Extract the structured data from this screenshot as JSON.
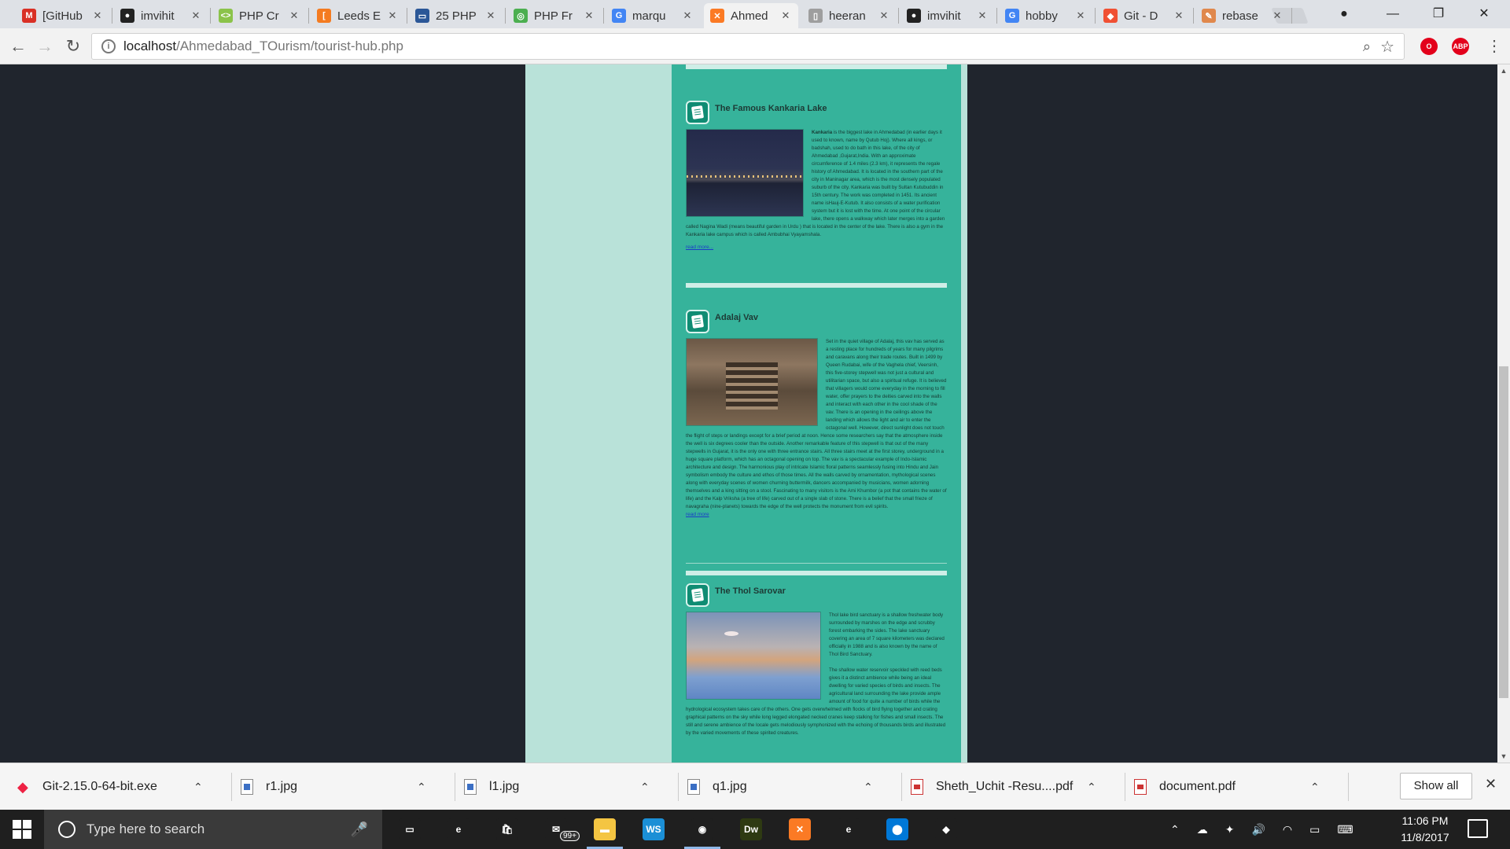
{
  "browser": {
    "tabs": [
      {
        "title": "[GitHub",
        "favicon": "gmail-icon",
        "color": "#d93025",
        "glyph": "M"
      },
      {
        "title": "imvihit",
        "favicon": "github-icon",
        "color": "#222222",
        "glyph": "●"
      },
      {
        "title": "PHP Cr",
        "favicon": "php-icon",
        "color": "#8bc34a",
        "glyph": "<>"
      },
      {
        "title": "Leeds E",
        "favicon": "leeds-icon",
        "color": "#f47b20",
        "glyph": "["
      },
      {
        "title": "25 PHP",
        "favicon": "monitor-icon",
        "color": "#2b5797",
        "glyph": "▭"
      },
      {
        "title": "PHP Fr",
        "favicon": "php-fr-icon",
        "color": "#4caf50",
        "glyph": "◎"
      },
      {
        "title": "marqu",
        "favicon": "google-icon",
        "color": "#4285f4",
        "glyph": "G"
      },
      {
        "title": "Ahmed",
        "favicon": "xampp-icon",
        "color": "#fb7a24",
        "glyph": "✕",
        "active": true
      },
      {
        "title": "heeran",
        "favicon": "page-icon",
        "color": "#9e9e9e",
        "glyph": "▯"
      },
      {
        "title": "imvihit",
        "favicon": "github-icon",
        "color": "#222222",
        "glyph": "●"
      },
      {
        "title": "hobby",
        "favicon": "google-icon",
        "color": "#4285f4",
        "glyph": "G"
      },
      {
        "title": "Git - D",
        "favicon": "git-icon",
        "color": "#f05033",
        "glyph": "◆"
      },
      {
        "title": "rebase",
        "favicon": "rebase-icon",
        "color": "#e0884c",
        "glyph": "✎"
      }
    ],
    "url_host": "localhost",
    "url_path": "/Ahmedabad_TOurism/tourist-hub.php"
  },
  "articles": [
    {
      "title": "The Famous Kankaria Lake",
      "lead": "Kankaria",
      "body": " is the biggest lake in Ahmedabad (in earlier days it used to known, name by Qutub Hoj). Where all kings, or badshah, used to do bath in this lake, of the city of Ahmedabad ,Gujarat,India. With an approximate circumference of 1.4 miles (2.3 km), it represents the regale history of Ahmedabad. It is located in the southern part of the city in Maninagar area, which is the most densely populated suburb of the city. Kankaria was built by Sultan Kutubuddin in 15th century. The work was completed in 1451. Its ancient name isHauj-E-Kutub. It also consists of a water purification system but it is lost with the time. At one point of the circular lake, there opens a walkway which later merges into a garden called Nagina Wadi (means beautiful garden in Urdu ) that is located in the center of the lake. There is also a gym in the Kankaria lake campus which is called Ambubhai Vyayamshala.",
      "read_more": "read more...",
      "image": "kankaria-lake-photo"
    },
    {
      "title": "Adalaj Vav",
      "lead": "",
      "body": "Set in the quiet village of Adalaj, this vav has served as a resting place for hundreds of years for many pilgrims and caravans along their trade routes. Built in 1499 by Queen Rudabai, wife of the Vaghela chief, Veersinh, this five-storey stepwell was not just a cultural and utilitarian space, but also a spiritual refuge. It is believed that villagers would come everyday in the morning to fill water, offer prayers to the deities carved into the walls and interact with each other in the cool shade of the vav. There is an opening in the ceilings above the landing which allows the light and air to enter the octagonal well. However, direct sunlight does not touch the flight of steps or landings except for a brief period at noon. Hence some researchers say that the atmosphere inside the well is six degrees cooler than the outside. Another remarkable feature of this stepwell is that out of the many stepwells in Gujarat, it is the only one with three entrance stairs. All three stairs meet at the first storey, underground in a huge square platform, which has an octagonal opening on top. The vav is a spectacular example of Indo-Islamic architecture and design. The harmonious play of intricate Islamic floral patterns seamlessly fusing into Hindu and Jain symbolism embody the culture and ethos of those times. All the walls carved by ornamentation, mythological scenes along with everyday scenes of women churning buttermilk, dancers accompanied by musicians, women adorning themselves and a king sitting on a stool. Fascinating to many visitors is the Ami Khumbor (a pot that contains the water of life) and the Kalp Vriksha (a tree of life) carved out of a single slab of stone. There is a belief that the small frieze of navagraha (nine-planets) towards the edge of the well protects the monument from evil spirits.",
      "read_more": "read more",
      "image": "adalaj-vav-photo"
    },
    {
      "title": "The Thol Sarovar",
      "lead": "",
      "body": "Thol lake bird sanctuary is a shallow freshwater body surrounded by marshes on the edge and scrubby forest embarking the sides. The lake sanctuary covering an area of 7 square kilometers was declared officially in 1988 and is also known by the name of Thol Bird Sanctuary.",
      "body2": "The shallow water reservoir speckled with reed beds gives it a distinct ambience while being an ideal dwelling for varied species of birds and insects. The agricultural land surrounding the lake provide ample amount of food for quite a number of birds while the hydrological ecosystem takes care of the others. One gets overwhelmed with flocks of bird flying together and crating graphical patterns on the sky while long legged elongated necked cranes keep stalking for fishes and small insects. The still and serene ambience of the locale gets melodiously symphonized with the echoing of thousands birds and illustrated by the varied movements of these spirited creatures.",
      "image": "thol-lake-photo"
    }
  ],
  "downloads": [
    {
      "name": "Git-2.15.0-64-bit.exe",
      "type": "git"
    },
    {
      "name": "r1.jpg",
      "type": "img"
    },
    {
      "name": "l1.jpg",
      "type": "img"
    },
    {
      "name": "q1.jpg",
      "type": "img"
    },
    {
      "name": "Sheth_Uchit -Resu....pdf",
      "type": "pdf"
    },
    {
      "name": "document.pdf",
      "type": "pdf"
    }
  ],
  "download_bar": {
    "show_all": "Show all"
  },
  "taskbar": {
    "search_placeholder": "Type here to search",
    "mail_badge": "99+",
    "time": "11:06 PM",
    "date": "11/8/2017",
    "apps": [
      {
        "name": "task-view-icon",
        "color": "#1f1f1f",
        "glyph": "▭"
      },
      {
        "name": "edge-icon",
        "color": "#1f1f1f",
        "glyph": "e"
      },
      {
        "name": "store-icon",
        "color": "#1f1f1f",
        "glyph": "🛍"
      },
      {
        "name": "mail-icon",
        "color": "#1f1f1f",
        "glyph": "✉"
      },
      {
        "name": "explorer-icon",
        "color": "#f4c542",
        "glyph": "▬"
      },
      {
        "name": "webstorm-icon",
        "color": "#1b8fd6",
        "glyph": "WS"
      },
      {
        "name": "chrome-icon",
        "color": "#1f1f1f",
        "glyph": "◉"
      },
      {
        "name": "dreamweaver-icon",
        "color": "#2e3a12",
        "glyph": "Dw"
      },
      {
        "name": "xampp-icon",
        "color": "#fb7a24",
        "glyph": "✕"
      },
      {
        "name": "ie-icon",
        "color": "#1f1f1f",
        "glyph": "e"
      },
      {
        "name": "maps-icon",
        "color": "#0078d7",
        "glyph": "⬤"
      },
      {
        "name": "git-icon",
        "color": "#1f1f1f",
        "glyph": "◆"
      }
    ]
  }
}
